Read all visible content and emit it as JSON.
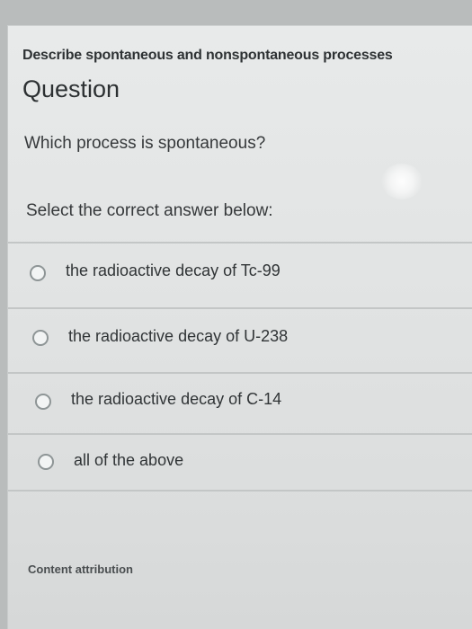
{
  "header": {
    "topic": "Describe spontaneous and nonspontaneous processes",
    "title": "Question"
  },
  "question": {
    "text": "Which process is spontaneous?",
    "instruction": "Select the correct answer below:"
  },
  "options": [
    {
      "label": "the radioactive decay of Tc-99",
      "selected": false
    },
    {
      "label": "the radioactive decay of U-238",
      "selected": false
    },
    {
      "label": "the radioactive decay of C-14",
      "selected": false
    },
    {
      "label": "all of the above",
      "selected": false
    }
  ],
  "footer": {
    "attribution": "Content attribution"
  }
}
